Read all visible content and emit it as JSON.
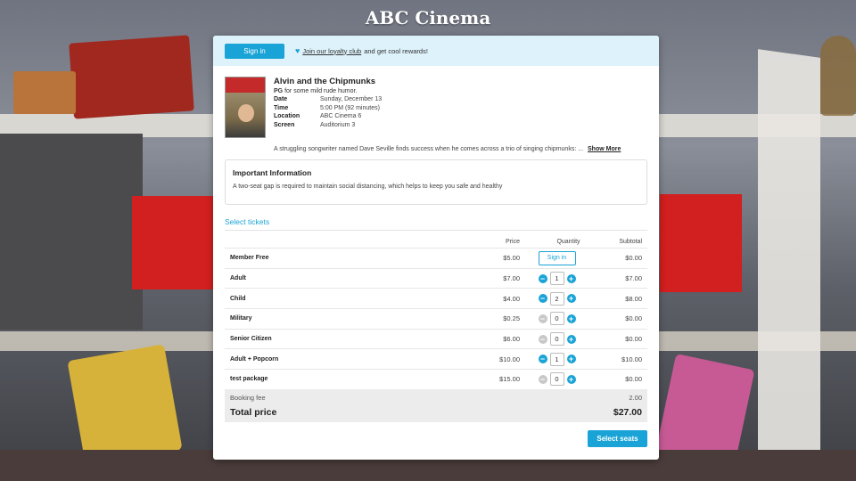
{
  "page": {
    "title": "ABC Cinema"
  },
  "topbar": {
    "signin_label": "Sign in",
    "loyalty_link": "Join our loyalty club",
    "loyalty_suffix": "and get cool rewards!",
    "heart_icon": "heart-icon"
  },
  "movie": {
    "title": "Alvin and the Chipmunks",
    "rating": "PG",
    "rating_reason": "for some mild rude humor.",
    "details": [
      {
        "key": "Date",
        "value": "Sunday, December 13"
      },
      {
        "key": "Time",
        "value": "5:00 PM (92 minutes)"
      },
      {
        "key": "Location",
        "value": "ABC Cinema 6"
      },
      {
        "key": "Screen",
        "value": "Auditorium 3"
      }
    ],
    "synopsis": "A struggling songwriter named Dave Seville finds success when he comes across a trio of singing chipmunks: ...",
    "show_more": "Show More"
  },
  "important": {
    "heading": "Important Information",
    "text": "A two-seat gap is required to maintain social distancing, which helps to keep you safe and healthy"
  },
  "tickets": {
    "section_label": "Select tickets",
    "headers": {
      "price": "Price",
      "quantity": "Quantity",
      "subtotal": "Subtotal"
    },
    "rows": [
      {
        "name": "Member Free",
        "price": "$5.00",
        "qty": "",
        "subtotal": "$0.00",
        "signin": "Sign in"
      },
      {
        "name": "Adult",
        "price": "$7.00",
        "qty": "1",
        "subtotal": "$7.00",
        "minus_enabled": true
      },
      {
        "name": "Child",
        "price": "$4.00",
        "qty": "2",
        "subtotal": "$8.00",
        "minus_enabled": true
      },
      {
        "name": "Military",
        "price": "$0.25",
        "qty": "0",
        "subtotal": "$0.00",
        "minus_enabled": false
      },
      {
        "name": "Senior Citizen",
        "price": "$6.00",
        "qty": "0",
        "subtotal": "$0.00",
        "minus_enabled": false
      },
      {
        "name": "Adult + Popcorn",
        "price": "$10.00",
        "qty": "1",
        "subtotal": "$10.00",
        "minus_enabled": true
      },
      {
        "name": "test package",
        "price": "$15.00",
        "qty": "0",
        "subtotal": "$0.00",
        "minus_enabled": false
      }
    ]
  },
  "totals": {
    "booking_fee_label": "Booking fee",
    "booking_fee_value": "2.00",
    "total_label": "Total price",
    "total_value": "$27.00"
  },
  "actions": {
    "select_seats": "Select seats"
  },
  "colors": {
    "accent": "#1aa3d6",
    "topbar_bg": "#ddf2fa",
    "disabled": "#c8c8c8"
  }
}
